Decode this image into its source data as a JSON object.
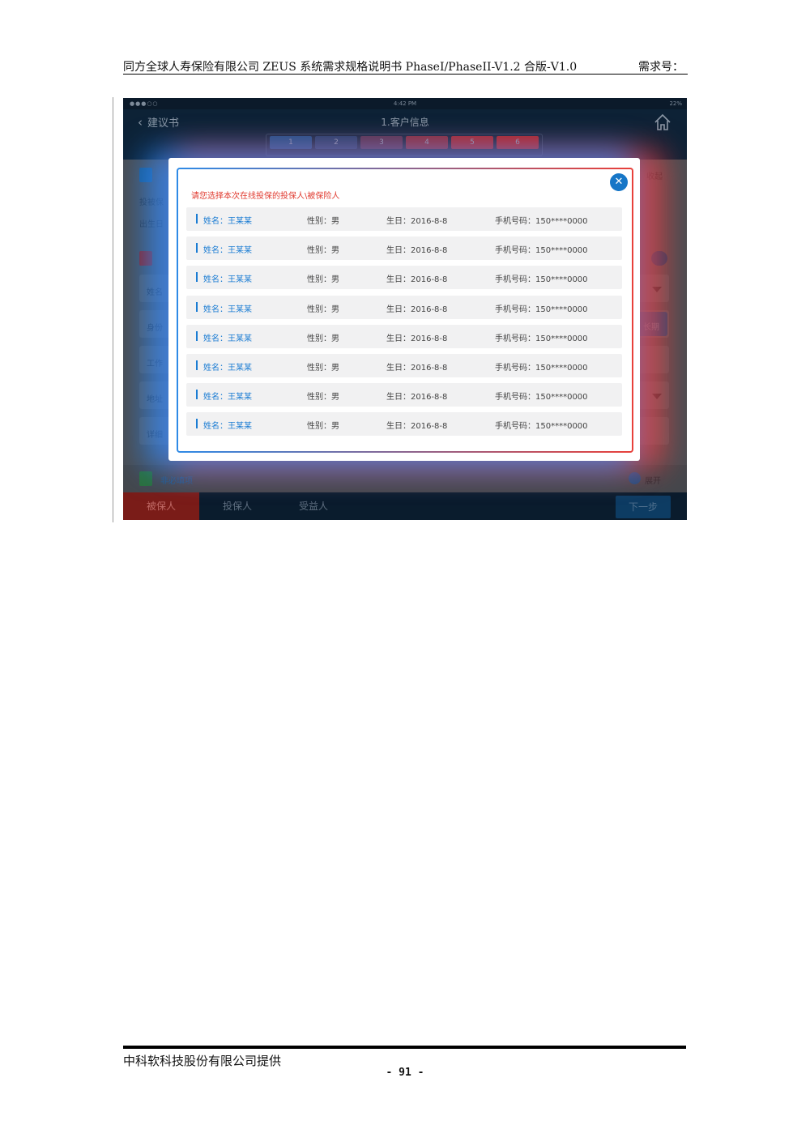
{
  "document": {
    "header_title": "同方全球人寿保险有限公司 ZEUS 系统需求规格说明书 PhaseI/PhaseII-V1.2  合版-V1.0",
    "header_req": "需求号：",
    "footer_company": "中科软科技股份有限公司提供",
    "page_number": "- 91 -"
  },
  "screen": {
    "status_bar": {
      "signal": "●●●○○",
      "time": "4:42 PM",
      "battery": "22%"
    },
    "nav": {
      "back_label": "建议书",
      "title": "1.客户信息",
      "steps": [
        "1",
        "2",
        "3",
        "4",
        "5",
        "6"
      ]
    },
    "background": {
      "labels": [
        "投被保",
        "出生日",
        "姓名",
        "身份",
        "工作",
        "地址",
        "详细"
      ],
      "right_labels": {
        "collapse": "收起",
        "date_btn": "长期",
        "expand": "展开"
      },
      "optional_label": "非必填项"
    },
    "bottom_tabs": [
      "被保人",
      "投保人",
      "受益人"
    ],
    "next_button": "下一步",
    "modal": {
      "prompt": "请您选择本次在线投保的投保人\\被保险人",
      "rows": [
        {
          "name": "姓名：王某某",
          "gender": "性别：男",
          "birthday": "生日：2016-8-8",
          "phone": "手机号码：150****0000"
        },
        {
          "name": "姓名：王某某",
          "gender": "性别：男",
          "birthday": "生日：2016-8-8",
          "phone": "手机号码：150****0000"
        },
        {
          "name": "姓名：王某某",
          "gender": "性别：男",
          "birthday": "生日：2016-8-8",
          "phone": "手机号码：150****0000"
        },
        {
          "name": "姓名：王某某",
          "gender": "性别：男",
          "birthday": "生日：2016-8-8",
          "phone": "手机号码：150****0000"
        },
        {
          "name": "姓名：王某某",
          "gender": "性别：男",
          "birthday": "生日：2016-8-8",
          "phone": "手机号码：150****0000"
        },
        {
          "name": "姓名：王某某",
          "gender": "性别：男",
          "birthday": "生日：2016-8-8",
          "phone": "手机号码：150****0000"
        },
        {
          "name": "姓名：王某某",
          "gender": "性别：男",
          "birthday": "生日：2016-8-8",
          "phone": "手机号码：150****0000"
        },
        {
          "name": "姓名：王某某",
          "gender": "性别：男",
          "birthday": "生日：2016-8-8",
          "phone": "手机号码：150****0000"
        }
      ]
    },
    "colors": {
      "accent_blue": "#1676c7",
      "prompt_red": "#e03a2f",
      "active_tab_red": "#b8231d",
      "step_colors": [
        "#1a4f86",
        "#1e3d66",
        "#55304a",
        "#8a2a35",
        "#a82528",
        "#b3201f"
      ]
    },
    "icons": [
      "chevron-left-icon",
      "home-icon",
      "document-icon",
      "form-icon",
      "user-search-icon",
      "edit-icon",
      "chevron-down-circle-icon",
      "close-icon"
    ]
  }
}
